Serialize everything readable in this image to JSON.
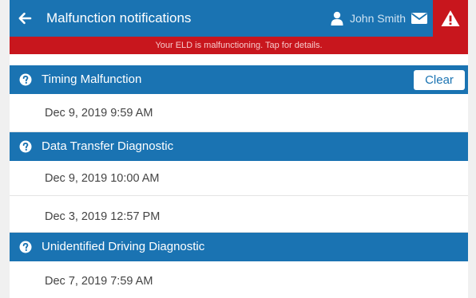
{
  "colors": {
    "primary": "#1a73b2",
    "alert": "#c8161d",
    "row_text": "#444444"
  },
  "header": {
    "title": "Malfunction notifications",
    "back_icon": "arrow-left-icon",
    "user_icon": "user-icon",
    "user_name": "John Smith",
    "mail_icon": "envelope-icon",
    "alert_icon": "warning-triangle-icon"
  },
  "banner": {
    "text": "Your ELD is malfunctioning. Tap for details."
  },
  "groups": [
    {
      "title": "Timing Malfunction",
      "icon": "question-circle-icon",
      "action_label": "Clear",
      "entries": [
        "Dec 9, 2019 9:59 AM"
      ]
    },
    {
      "title": "Data Transfer Diagnostic",
      "icon": "question-circle-icon",
      "entries": [
        "Dec 9, 2019 10:00 AM",
        "Dec 3, 2019 12:57 PM"
      ]
    },
    {
      "title": "Unidentified Driving Diagnostic",
      "icon": "question-circle-icon",
      "entries": [
        "Dec 7, 2019 7:59 AM"
      ]
    }
  ]
}
